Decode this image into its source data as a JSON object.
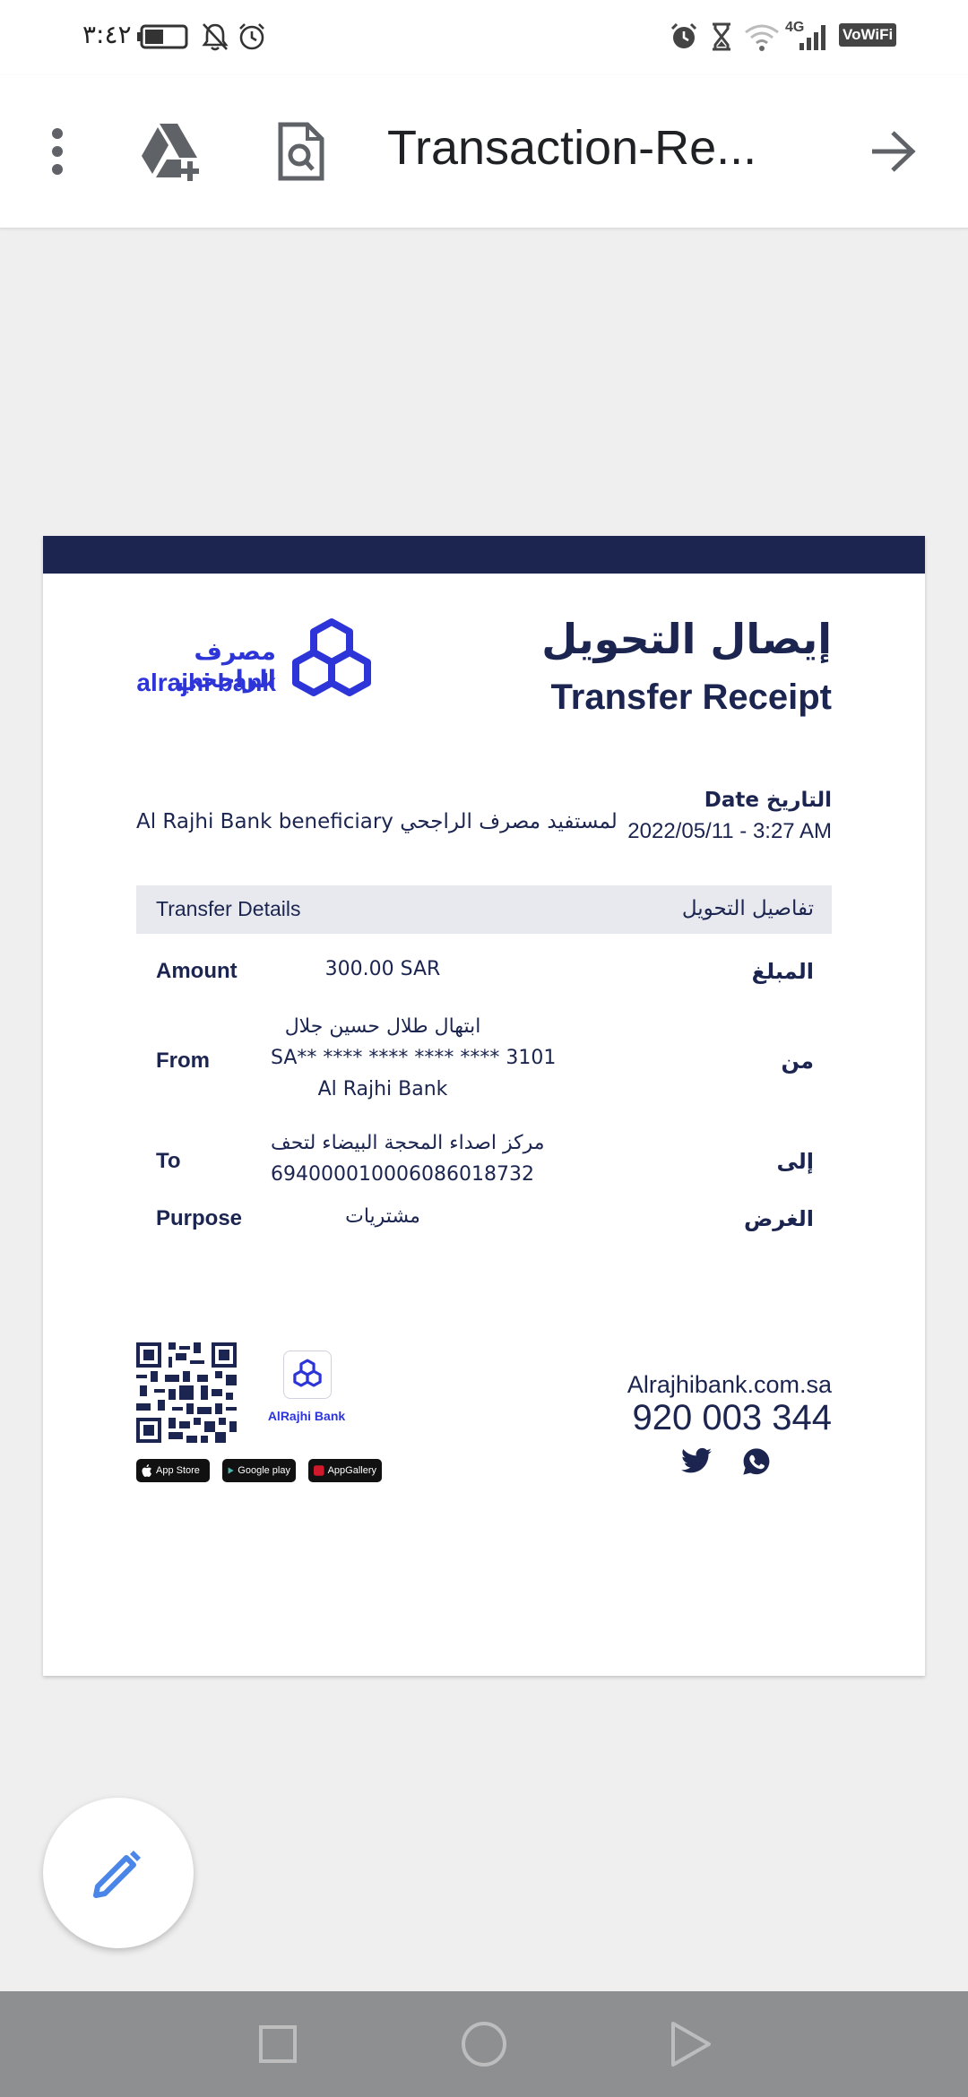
{
  "status_bar": {
    "time": "٣:٤٢",
    "network": "4G",
    "vowifi": "VoWiFi",
    "icons": [
      "battery-icon",
      "mute-icon",
      "alarm-icon",
      "alarm-icon",
      "hourglass-icon",
      "wifi-icon",
      "signal-icon"
    ]
  },
  "toolbar": {
    "title": "Transaction-Re...",
    "icons": [
      "more-vert-icon",
      "add-to-drive-icon",
      "find-in-document-icon",
      "forward-arrow-icon"
    ]
  },
  "receipt": {
    "title_ar": "إيصال التحويل",
    "title_en": "Transfer Receipt",
    "bank_name_ar": "مصرف الراجحي",
    "bank_name_en": "alrajhi bank",
    "date_label": "Date التاريخ",
    "date_value": "2022/05/11 - 3:27 AM",
    "beneficiary": "Al Rajhi Bank beneficiary لمستفيد مصرف الراجحي",
    "details_header_en": "Transfer Details",
    "details_header_ar": "تفاصيل التحويل",
    "rows": [
      {
        "label_en": "Amount",
        "label_ar": "المبلغ",
        "lines": [
          "300.00 SAR"
        ]
      },
      {
        "label_en": "From",
        "label_ar": "من",
        "lines": [
          "ابتهال طلال حسين جلال",
          "SA** **** **** **** **** 3101",
          "Al Rajhi Bank"
        ]
      },
      {
        "label_en": "To",
        "label_ar": "إلى",
        "lines": [
          "مركز اصداء المحجة البيضاء لتحف",
          "694000010006086018732"
        ]
      },
      {
        "label_en": "Purpose",
        "label_ar": "الغرض",
        "lines": [
          "مشتريات"
        ]
      }
    ],
    "app_name": "AlRajhi Bank",
    "store_badges": [
      {
        "small": "Available on the",
        "name": "App Store"
      },
      {
        "small": "Get it on",
        "name": "Google play"
      },
      {
        "small": "EXPLORE IT ON",
        "name": "AppGallery"
      }
    ],
    "website": "Alrajhibank.com.sa",
    "phone": "920 003 344",
    "social_icons": [
      "twitter-icon",
      "whatsapp-icon"
    ]
  },
  "fab": {
    "icon": "edit-pencil-icon"
  },
  "nav_bar": {
    "icons": [
      "recents-square-icon",
      "home-circle-icon",
      "back-triangle-icon"
    ]
  },
  "colors": {
    "navy": "#1b2550",
    "brand_blue": "#2d35d8",
    "page_bg": "#efeff0",
    "fab_icon": "#4a86e8"
  }
}
